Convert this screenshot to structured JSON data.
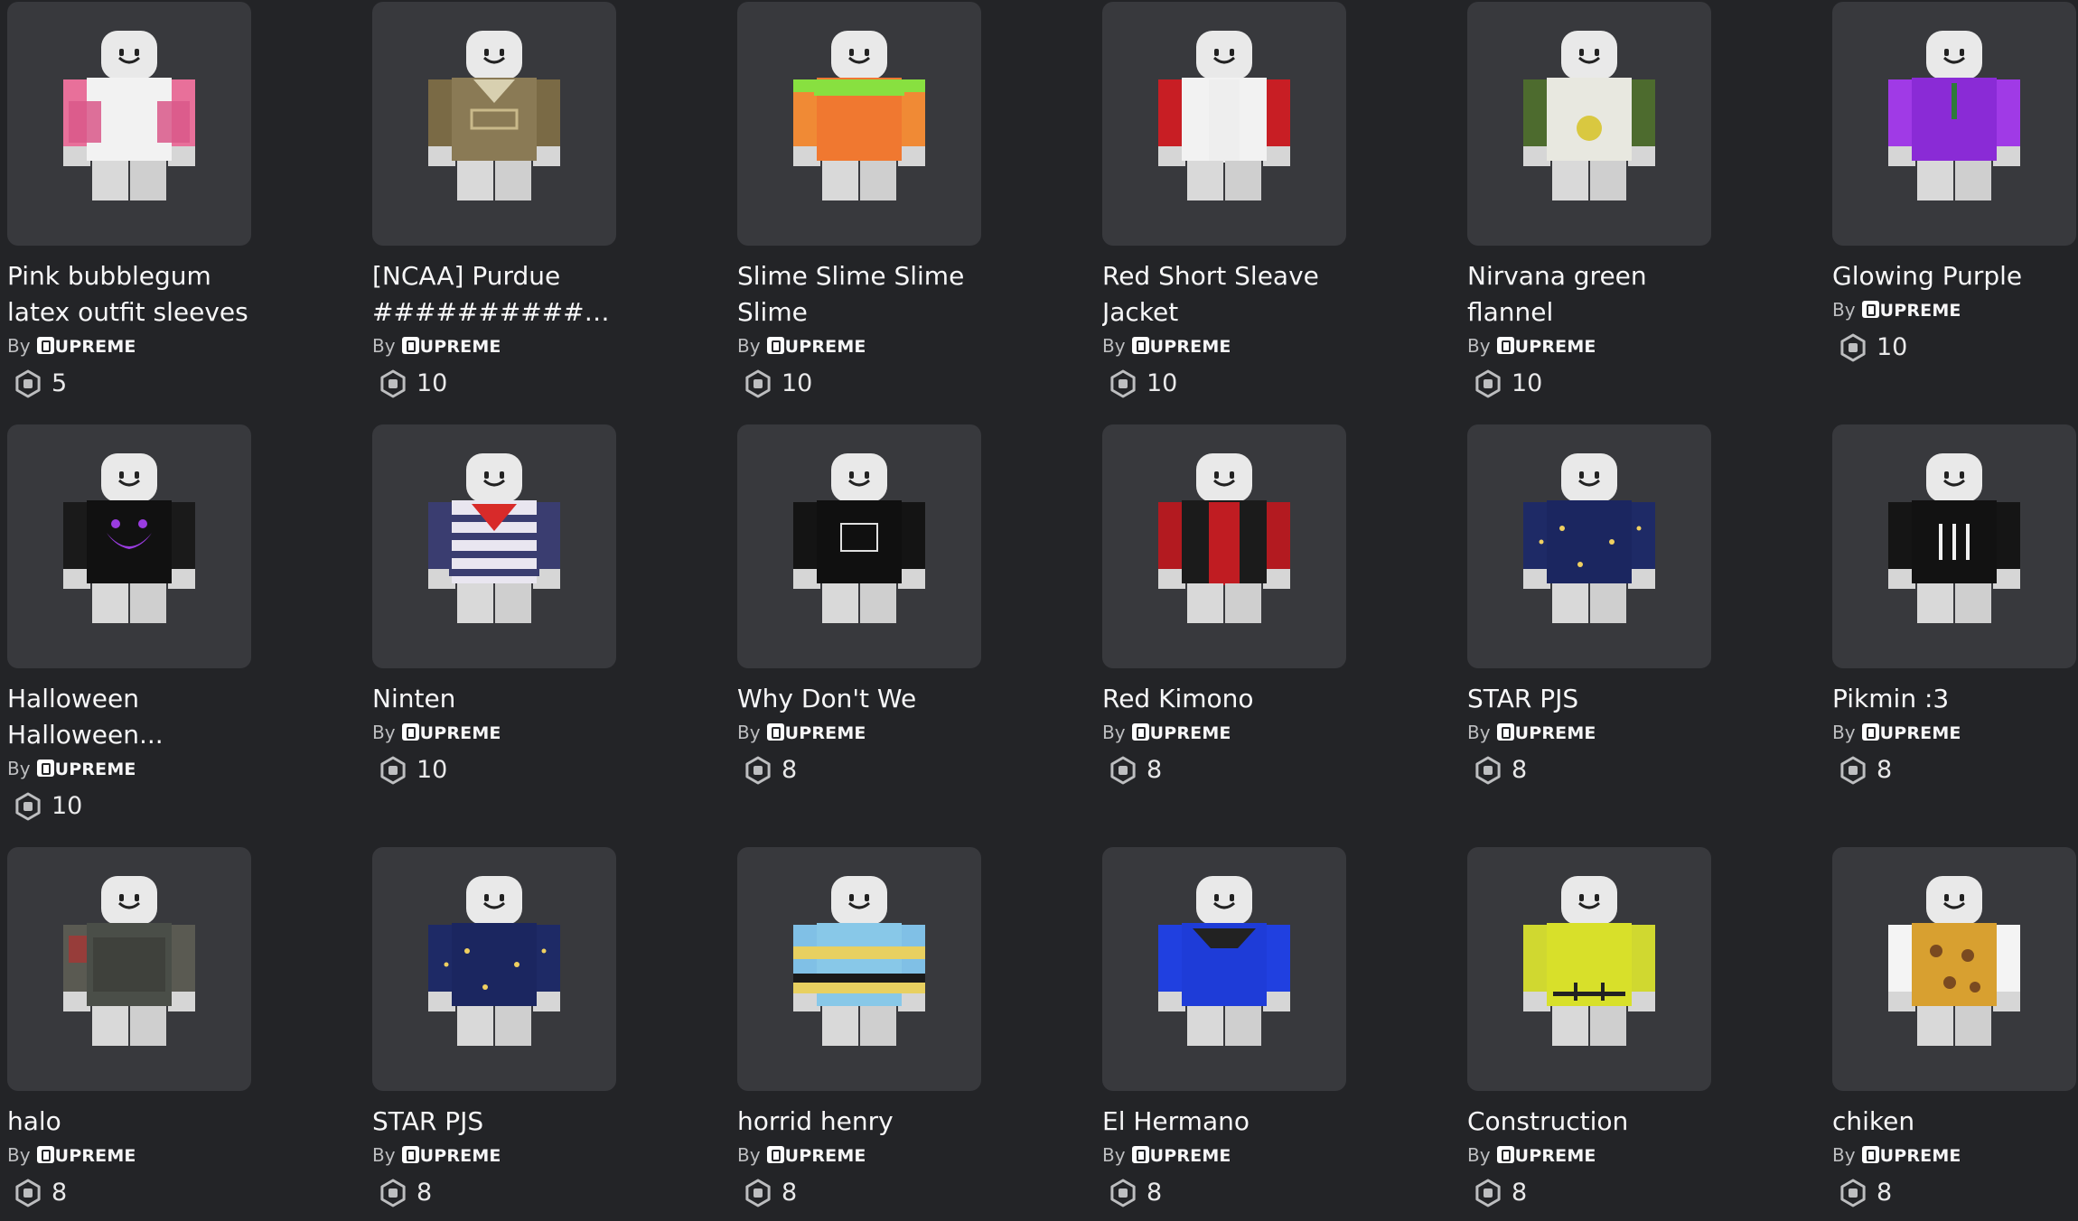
{
  "by_label": "By",
  "items": [
    {
      "name": "Pink bubblegum latex outfit sleeves",
      "creator": "UPREME",
      "price": "5",
      "torso": "#f2f2f2",
      "sleeve": "#e8709a",
      "accent": "#d9588a",
      "icon": "pink-sleeve-shirt-icon"
    },
    {
      "name": "[NCAA] Purdue ##############...",
      "creator": "UPREME",
      "price": "10",
      "torso": "#8a7a55",
      "sleeve": "#7a6a45",
      "accent": "#c9b98a",
      "icon": "military-vest-shirt-icon"
    },
    {
      "name": "Slime Slime Slime Slime",
      "creator": "UPREME",
      "price": "10",
      "torso": "#f07830",
      "sleeve": "#f08a35",
      "accent": "#88e040",
      "icon": "slime-shirt-icon"
    },
    {
      "name": "Red Short Sleave Jacket",
      "creator": "UPREME",
      "price": "10",
      "torso": "#f2f2f2",
      "sleeve": "#c81e24",
      "accent": "#d52a2a",
      "icon": "red-jacket-shirt-icon"
    },
    {
      "name": "Nirvana green flannel",
      "creator": "UPREME",
      "price": "10",
      "torso": "#e8e8e0",
      "sleeve": "#4d6b2e",
      "accent": "#d9c840",
      "icon": "green-flannel-shirt-icon"
    },
    {
      "name": "Glowing Purple",
      "creator": "UPREME",
      "price": "10",
      "torso": "#8a2bd6",
      "sleeve": "#a03ae6",
      "accent": "#2e7a3a",
      "icon": "purple-suit-shirt-icon"
    },
    {
      "name": "Halloween Halloween...",
      "creator": "UPREME",
      "price": "10",
      "torso": "#111111",
      "sleeve": "#1a1a1a",
      "accent": "#9a3ce0",
      "icon": "halloween-hoodie-shirt-icon"
    },
    {
      "name": "Ninten",
      "creator": "UPREME",
      "price": "10",
      "torso": "#e9e6f0",
      "sleeve": "#3a3d70",
      "accent": "#d82a2a",
      "icon": "striped-bandana-shirt-icon"
    },
    {
      "name": "Why Don't We",
      "creator": "UPREME",
      "price": "8",
      "torso": "#101010",
      "sleeve": "#141414",
      "accent": "#e0e0e0",
      "icon": "black-tee-shirt-icon"
    },
    {
      "name": "Red Kimono",
      "creator": "UPREME",
      "price": "8",
      "torso": "#1b1b1b",
      "sleeve": "#b31a20",
      "accent": "#d02a2a",
      "icon": "red-kimono-shirt-icon"
    },
    {
      "name": "STAR PJS",
      "creator": "UPREME",
      "price": "8",
      "torso": "#1b2660",
      "sleeve": "#1e2a66",
      "accent": "#f0d060",
      "icon": "star-pajama-shirt-icon"
    },
    {
      "name": "Pikmin :3",
      "creator": "UPREME",
      "price": "8",
      "torso": "#121212",
      "sleeve": "#151515",
      "accent": "#f0f0f0",
      "icon": "pikmin-tee-shirt-icon"
    },
    {
      "name": "halo",
      "creator": "UPREME",
      "price": "8",
      "torso": "#4a4e48",
      "sleeve": "#5a5a52",
      "accent": "#b03030",
      "icon": "camo-armor-shirt-icon"
    },
    {
      "name": "STAR PJS",
      "creator": "UPREME",
      "price": "8",
      "torso": "#1b2660",
      "sleeve": "#1e2a66",
      "accent": "#f0d060",
      "icon": "star-pajama-shirt-icon"
    },
    {
      "name": "horrid henry",
      "creator": "UPREME",
      "price": "8",
      "torso": "#88c8e8",
      "sleeve": "#80c0e6",
      "accent": "#e8d060",
      "icon": "striped-sweater-shirt-icon"
    },
    {
      "name": "El Hermano",
      "creator": "UPREME",
      "price": "8",
      "torso": "#1e3cd8",
      "sleeve": "#2040e0",
      "accent": "#222222",
      "icon": "blue-shirt-icon"
    },
    {
      "name": "Construction",
      "creator": "UPREME",
      "price": "8",
      "torso": "#d8e02a",
      "sleeve": "#d0d830",
      "accent": "#222222",
      "icon": "hi-vis-vest-shirt-icon"
    },
    {
      "name": "chiken",
      "creator": "UPREME",
      "price": "8",
      "torso": "#d8a030",
      "sleeve": "#f4f4f4",
      "accent": "#7a4a20",
      "icon": "nugget-vest-shirt-icon"
    }
  ]
}
